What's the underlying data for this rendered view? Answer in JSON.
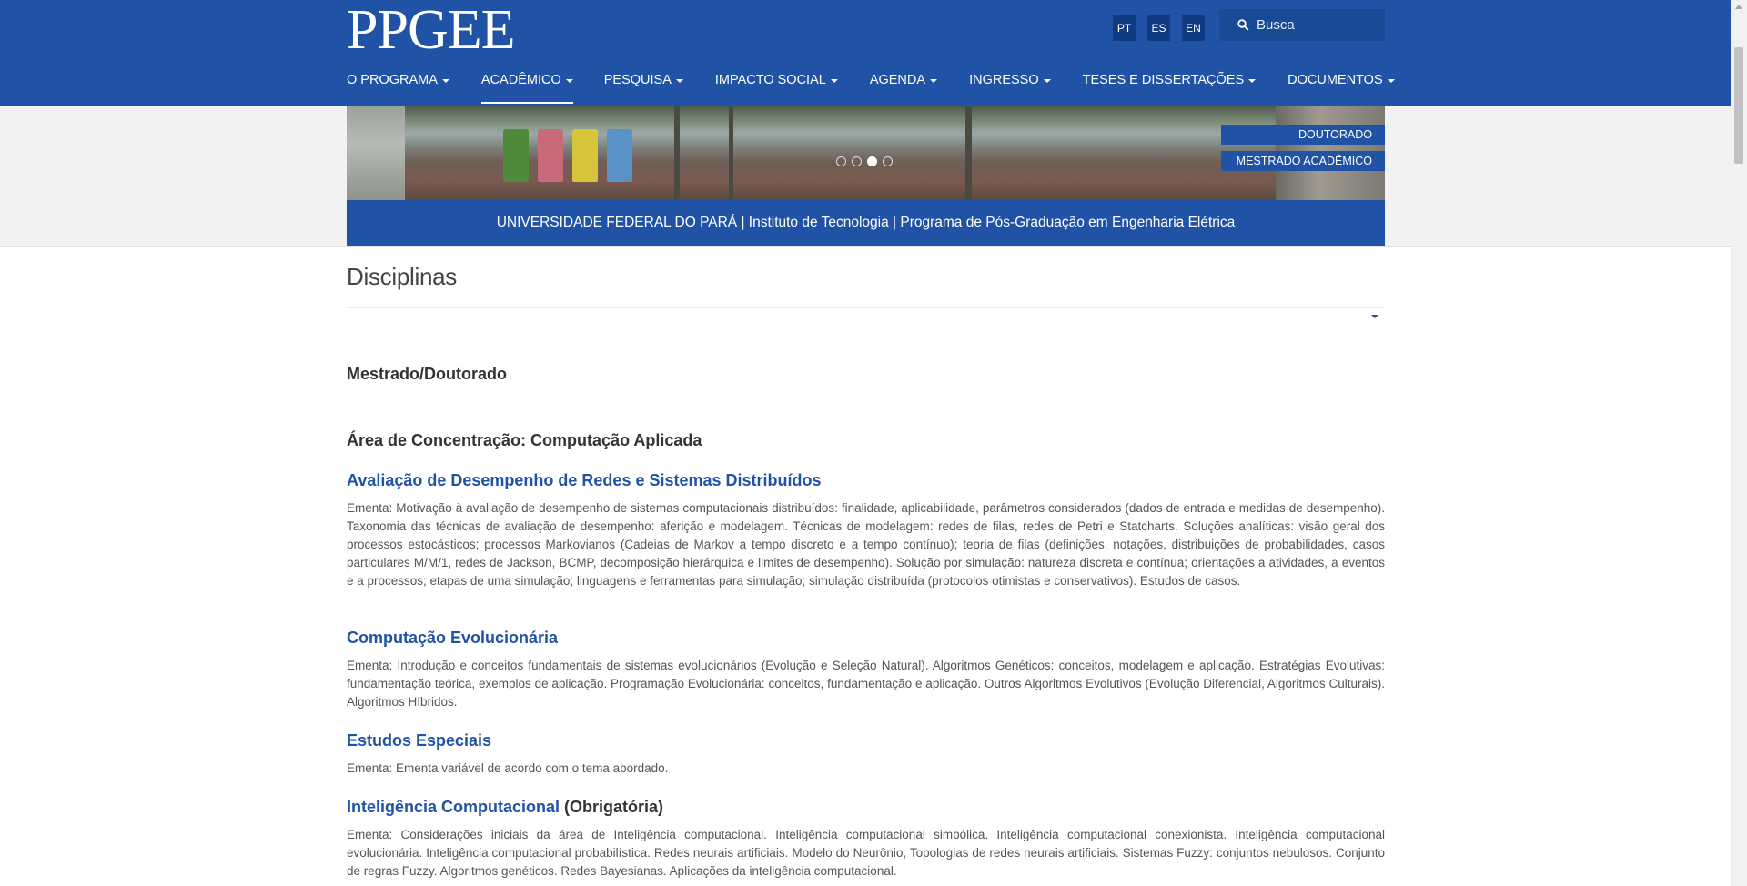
{
  "header": {
    "logo": "PPGEE",
    "languages": [
      "PT",
      "ES",
      "EN"
    ],
    "search_placeholder": "Busca",
    "nav": [
      {
        "label": "O PROGRAMA"
      },
      {
        "label": "ACADÊMICO",
        "active": true
      },
      {
        "label": "PESQUISA"
      },
      {
        "label": "IMPACTO SOCIAL"
      },
      {
        "label": "AGENDA"
      },
      {
        "label": "INGRESSO"
      },
      {
        "label": "TESES E DISSERTAÇÕES"
      },
      {
        "label": "DOCUMENTOS"
      }
    ]
  },
  "banner": {
    "tags": [
      "DOUTORADO",
      "MESTRADO ACADÊMICO"
    ],
    "slides": 4,
    "active_slide": 3,
    "institution_line": "UNIVERSIDADE FEDERAL DO PARÁ | Instituto de Tecnologia | Programa de Pós-Graduação em Engenharia Elétrica"
  },
  "page": {
    "title": "Disciplinas",
    "level_heading": "Mestrado/Doutorado",
    "area_heading": "Área de Concentração: Computação Aplicada",
    "courses": [
      {
        "title": "Avaliação de Desempenho de Redes e Sistemas Distribuídos",
        "suffix": "",
        "ementa": "Ementa: Motivação à avaliação de desempenho de sistemas computacionais distribuídos: finalidade, aplicabilidade, parâmetros considerados (dados de entrada e medidas de desempenho). Taxonomia das técnicas de avaliação de desempenho: aferição e modelagem. Técnicas de modelagem: redes de filas, redes de Petri e Statcharts. Soluções analíticas: visão geral dos processos estocásticos; processos Markovianos (Cadeias de Markov a tempo discreto e a tempo contínuo); teoria de filas (definições, notações, distribuições de probabilidades, casos particulares M/M/1, redes de Jackson, BCMP, decomposição hierárquica e limites de desempenho). Solução por simulação: natureza discreta e contínua; orientações a atividades, a eventos e a processos; etapas de uma simulação; linguagens e ferramentas para simulação; simulação distribuída (protocolos otimistas e conservativos). Estudos de casos."
      },
      {
        "title": "Computação Evolucionária",
        "suffix": "",
        "ementa": "Ementa: Introdução e conceitos fundamentais de sistemas evolucionários (Evolução e Seleção Natural). Algoritmos Genéticos: conceitos, modelagem e aplicação. Estratégias Evolutivas: fundamentação teórica, exemplos de aplicação. Programação Evolucionária: conceitos, fundamentação e aplicação. Outros Algoritmos Evolutivos (Evolução Diferencial, Algoritmos Culturais). Algoritmos Híbridos."
      },
      {
        "title": "Estudos Especiais",
        "suffix": "",
        "ementa": "Ementa: Ementa variável de acordo com o tema abordado."
      },
      {
        "title": "Inteligência Computacional",
        "suffix": " (Obrigatória)",
        "ementa": "Ementa: Considerações iniciais da área de Inteligência computacional. Inteligência computacional simbólica. Inteligência computacional conexionista. Inteligência computacional evolucionária. Inteligência computacional probabilística. Redes neurais artificiais. Modelo do Neurônio, Topologias de redes neurais artificiais. Sistemas Fuzzy: conjuntos nebulosos. Conjunto de regras Fuzzy. Algoritmos genéticos. Redes Bayesianas. Aplicações da inteligência computacional."
      }
    ]
  },
  "colors": {
    "brand_blue": "#2053a5",
    "lang_button": "#103a82",
    "link_blue": "#2053a5"
  },
  "icons": {
    "search": "search-icon",
    "caret": "caret-down-icon"
  }
}
